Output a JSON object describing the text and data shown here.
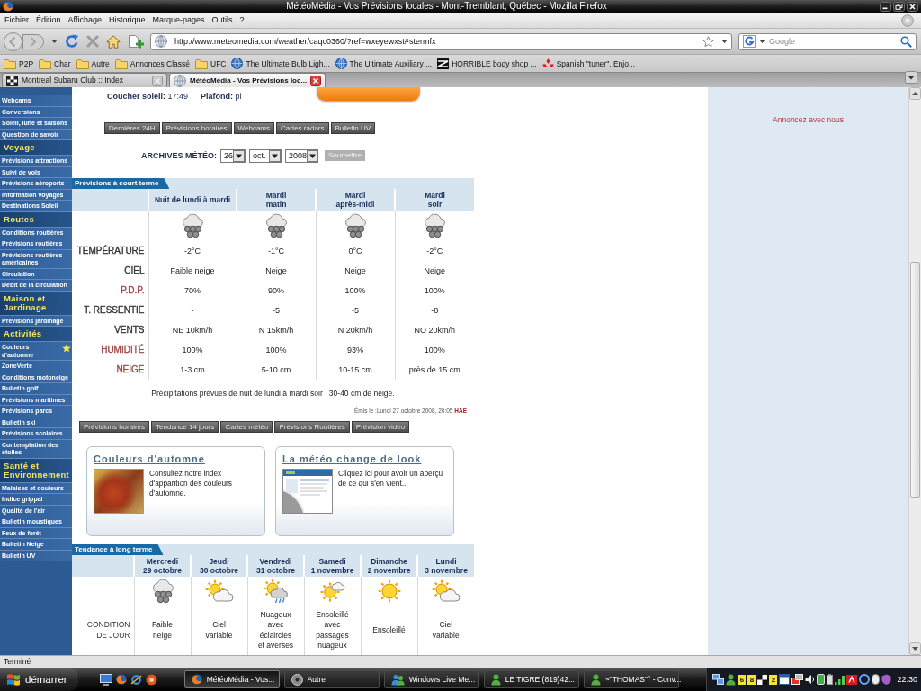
{
  "window": {
    "title": "MétéoMédia - Vos Prévisions locales - Mont-Tremblant, Québec - Mozilla Firefox"
  },
  "menu": [
    "Fichier",
    "Édition",
    "Affichage",
    "Historique",
    "Marque-pages",
    "Outils",
    "?"
  ],
  "address_bar": {
    "url": "http://www.meteomedia.com/weather/caqc0360/?ref=wxeyewxst#stermfx"
  },
  "search": {
    "placeholder": "Google"
  },
  "bookmarks": [
    {
      "kind": "folder",
      "label": "P2P"
    },
    {
      "kind": "folder",
      "label": "Char"
    },
    {
      "kind": "folder",
      "label": "Autre"
    },
    {
      "kind": "folder",
      "label": "Annonces Classé"
    },
    {
      "kind": "folder",
      "label": "UFC"
    },
    {
      "kind": "globe",
      "label": "The Ultimate Bulb Ligh..."
    },
    {
      "kind": "globe",
      "label": "The Ultimate Auxiliary ..."
    },
    {
      "kind": "stripes",
      "label": "HORRIBLE body shop ..."
    },
    {
      "kind": "diamonds",
      "label": "Spanish \"tuner\". Enjo..."
    }
  ],
  "tabs": [
    {
      "kind": "checkered",
      "label": "Montreal Subaru Club :: Index",
      "selected": false
    },
    {
      "kind": "globe",
      "label": "MétéoMédia - Vos Prévisions loc...",
      "selected": true
    }
  ],
  "sidebar": {
    "sections": [
      {
        "items": [
          {
            "label": "Webcams",
            "starred": false
          },
          {
            "label": "Conversions",
            "starred": false
          },
          {
            "label": "Soleil, lune et saisons",
            "starred": false
          },
          {
            "label": "Question de savoir",
            "starred": false
          }
        ]
      },
      {
        "title": "Voyage",
        "items": [
          {
            "label": "Prévisions attractions",
            "starred": false
          },
          {
            "label": "Suivi de vols",
            "starred": false
          },
          {
            "label": "Prévisions aéroports",
            "starred": false
          },
          {
            "label": "Information voyages",
            "starred": false
          },
          {
            "label": "Destinations Soleil",
            "starred": false
          }
        ]
      },
      {
        "title": "Routes",
        "items": [
          {
            "label": "Conditions routières",
            "starred": false
          },
          {
            "label": "Prévisions routières",
            "starred": false
          },
          {
            "label": "Prévisions routières américaines",
            "starred": false
          },
          {
            "label": "Circulation",
            "starred": false
          },
          {
            "label": "Débit de la circulation",
            "starred": false
          }
        ]
      },
      {
        "title": "Maison et Jardinage",
        "items": [
          {
            "label": "Prévisions jardinage",
            "starred": false
          }
        ]
      },
      {
        "title": "Activités",
        "items": [
          {
            "label": "Couleurs d'automne",
            "starred": true
          },
          {
            "label": "ZoneVerte",
            "starred": false
          },
          {
            "label": "Conditions motoneige",
            "starred": false
          },
          {
            "label": "Bulletin golf",
            "starred": false
          },
          {
            "label": "Prévisions maritimes",
            "starred": false
          },
          {
            "label": "Prévisions parcs",
            "starred": false
          },
          {
            "label": "Bulletin ski",
            "starred": false
          },
          {
            "label": "Prévisions scolaires",
            "starred": false
          },
          {
            "label": "Contemplation des étoiles",
            "starred": false
          }
        ]
      },
      {
        "title": "Santé et Environnement",
        "items": [
          {
            "label": "Malaises et douleurs",
            "starred": false
          },
          {
            "label": "Indice grippal",
            "starred": false
          },
          {
            "label": "Qualité de l'air",
            "starred": false
          },
          {
            "label": "Bulletin moustiques",
            "starred": false
          },
          {
            "label": "Feux de forêt",
            "starred": false
          },
          {
            "label": "Bulletin Neige",
            "starred": false
          },
          {
            "label": "Bulletin UV",
            "starred": false
          }
        ]
      }
    ]
  },
  "page": {
    "sun_info": [
      "**Coucher soleil:** 17:49",
      "**Plafond:** pi"
    ],
    "top_buttons": [
      "Dernières 24H",
      "Prévisions horaires",
      "Webcams",
      "Cartes radars",
      "Bulletin UV"
    ],
    "archive": {
      "label": "ARCHIVES MÉTÉO:",
      "selects": [
        "26",
        "oct.",
        "2008"
      ],
      "submit": "Soumettre"
    },
    "short_term": {
      "title": "Prévisions à court terme",
      "periods": [
        {
          "heading": [
            "Nuit de lundi à mardi"
          ],
          "kind": "snow"
        },
        {
          "heading": [
            "Mardi",
            "matin"
          ],
          "kind": "snow"
        },
        {
          "heading": [
            "Mardi",
            "après-midi"
          ],
          "kind": "snow"
        },
        {
          "heading": [
            "Mardi",
            "soir"
          ],
          "kind": "snow"
        }
      ],
      "rows": [
        {
          "label": "TEMPÉRATURE",
          "color": "#333333",
          "values": [
            "-2°C",
            "-1°C",
            "0°C",
            "-2°C"
          ]
        },
        {
          "label": "CIEL",
          "color": "#333333",
          "values": [
            "Faible neige",
            "Neige",
            "Neige",
            "Neige"
          ]
        },
        {
          "label": "P.D.P.",
          "color": "#a04646",
          "values": [
            "70%",
            "90%",
            "100%",
            "100%"
          ]
        },
        {
          "label": "T. RESSENTIE",
          "color": "#333333",
          "values": [
            "-",
            "-5",
            "-5",
            "-8"
          ]
        },
        {
          "label": "VENTS",
          "color": "#333333",
          "values": [
            "NE 10km/h",
            "N 15km/h",
            "N 20km/h",
            "NO 20km/h"
          ]
        },
        {
          "label": "HUMIDITÉ",
          "color": "#a04646",
          "values": [
            "100%",
            "100%",
            "93%",
            "100%"
          ]
        },
        {
          "label": "NEIGE",
          "color": "#a04646",
          "values": [
            "1-3 cm",
            "5-10 cm",
            "10-15 cm",
            "près de 15 cm"
          ]
        }
      ]
    },
    "precipitation_note": "Précipitations prévues de nuit de lundi à mardi soir : 30-40 cm de neige.",
    "issued": "Émis le :Lundi 27 octobre 2008, 20:05 **HAE**",
    "bottom_buttons": [
      "Prévisions horaires",
      "Tendance 14 jours",
      "Cartes météo",
      "Prévisions Routières",
      "Prévision video"
    ],
    "promos": [
      {
        "kind": "photo",
        "title": "Couleurs d'automne",
        "text": "Consultez notre index d'apparition des couleurs d'automne."
      },
      {
        "kind": "thumbnail",
        "title": "La météo change de look",
        "text": "Cliquez ici pour avoir un aperçu de ce qui s'en vient..."
      }
    ],
    "long_term": {
      "title": "Tendance à long terme",
      "row_label": "CONDITION DE JOUR",
      "days": [
        {
          "day": "Mercredi",
          "date": "29 octobre",
          "kind": "snow",
          "condition": "Faible neige"
        },
        {
          "day": "Jeudi",
          "date": "30 octobre",
          "kind": "sun_cloud",
          "condition": "Ciel variable"
        },
        {
          "day": "Vendredi",
          "date": "31 octobre",
          "kind": "sun_cloud_showers",
          "condition": "Nuageux avec éclaircies et averses"
        },
        {
          "day": "Samedi",
          "date": "1 novembre",
          "kind": "sun_small_cloud",
          "condition": "Ensoleillé avec passages nuageux"
        },
        {
          "day": "Dimanche",
          "date": "2 novembre",
          "kind": "sun",
          "condition": "Ensoleillé"
        },
        {
          "day": "Lundi",
          "date": "3 novembre",
          "kind": "sun_cloud",
          "condition": "Ciel variable"
        }
      ]
    }
  },
  "ad": "Annoncez avec nous",
  "status_bar": "Terminé",
  "taskbar": {
    "start": "démarrer",
    "tasks": [
      {
        "kind": "browser",
        "label": "MétéoMédia - Vos...",
        "selected": true
      },
      {
        "kind": "disc",
        "label": "Autre",
        "selected": false
      },
      {
        "kind": "people",
        "label": "Windows Live Me...",
        "selected": false
      },
      {
        "kind": "person",
        "label": "LE TIGRE (819)42...",
        "selected": false
      },
      {
        "kind": "person",
        "label": "~\"THOMAS\"° - Conv...",
        "selected": false
      }
    ],
    "tray_badges": [
      "6",
      "8",
      "2"
    ],
    "clock": "22:30"
  }
}
